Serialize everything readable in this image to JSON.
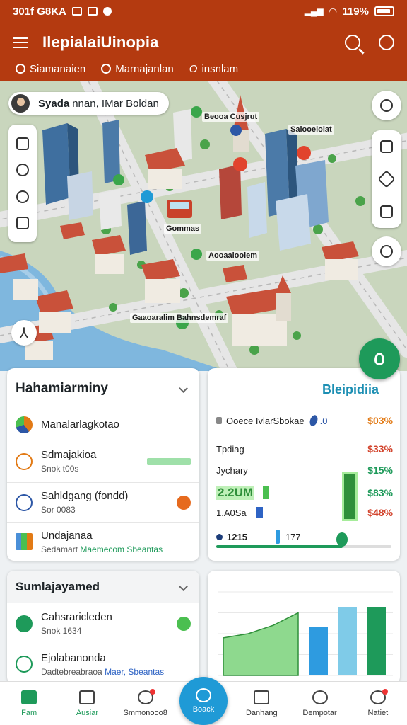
{
  "status_bar": {
    "left_text": "301f G8KA",
    "battery": "119%"
  },
  "app_bar": {
    "title": "IlepialaiUinopia"
  },
  "chips": [
    {
      "label": "Siamanaien"
    },
    {
      "label": "Marnajanlan"
    },
    {
      "label": "insnlam"
    }
  ],
  "map": {
    "user_chip": {
      "name": "Syada",
      "rest": "nnan, IMar Boldan"
    },
    "labels": [
      "Beooa Cusjrut",
      "Salooeioiat",
      "Aooaaioolem",
      "Gommas",
      "Gaaoaralim Bahnsdemraf"
    ]
  },
  "left_card": {
    "title": "Hahamiarminy",
    "rows": [
      {
        "title": "Manalarlagkotao",
        "sub": "",
        "icon_color": "#e27a15"
      },
      {
        "title": "Sdmajakioa",
        "sub": "Snok t00s",
        "icon_color": "#e27a15"
      },
      {
        "title": "Sahldgang (fondd)",
        "sub": "Sor 0083",
        "icon_color": "#2d57a6"
      },
      {
        "title": "Undajanaa",
        "sub_plain": "Sedamart ",
        "sub_green": "Maemecom Sbeantas",
        "icon_color": "#4a8fd8"
      }
    ]
  },
  "stats_card": {
    "title": "Bleipidiia",
    "rows": [
      {
        "label": "Ooece IvlarSbokae",
        "extra": ".0",
        "value": "$03%",
        "tone": "orange"
      },
      {
        "label": "Tpdiag",
        "extra": "",
        "value": "$33%",
        "tone": "red"
      },
      {
        "label": "Jychary",
        "extra": "",
        "value": "$15%",
        "tone": "green"
      },
      {
        "label": "2.2UM",
        "extra": "",
        "value": "$83%",
        "tone": "green"
      },
      {
        "label": "1.A0Sa",
        "extra": "",
        "value": "$48%",
        "tone": "red"
      },
      {
        "label": "1215",
        "extra": "177",
        "value": "",
        "tone": "green"
      }
    ]
  },
  "left_card2": {
    "title": "Sumlajayamed",
    "rows": [
      {
        "title": "Cahsraricleden",
        "sub": "Snok 1634",
        "icon_color": "#1e9a5a"
      },
      {
        "title": "Ejolabanonda",
        "sub_plain": "Dadtebreabraoa ",
        "sub_green": "Maer, Sbeantas",
        "icon_color": "#1e9a5a"
      }
    ]
  },
  "chart_data": {
    "type": "bar",
    "series": [
      {
        "values": [
          0.52,
          0.72
        ]
      },
      {
        "values": [
          0.56,
          0.78,
          0.78
        ]
      }
    ],
    "area_values": [
      0.45,
      0.5,
      0.6,
      0.75
    ],
    "colors": {
      "area": "#8ed98e",
      "bar1": "#2e9be0",
      "bar2": "#7fcbe8",
      "bar3": "#1e9a5a"
    }
  },
  "bottom_nav": {
    "items": [
      {
        "label": "Fam"
      },
      {
        "label": "Ausiar"
      },
      {
        "label": "Smmonooo8"
      },
      {
        "label": "Danhang"
      },
      {
        "label": "Dempotar"
      },
      {
        "label": "Natiet"
      }
    ],
    "center_label": "Boack"
  }
}
